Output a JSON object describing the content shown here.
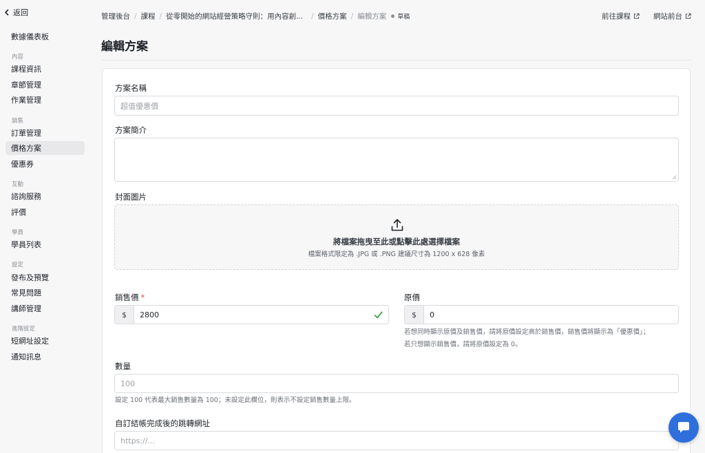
{
  "sidebar": {
    "back_label": "返回",
    "items": [
      {
        "type": "item",
        "label": "數據儀表板"
      },
      {
        "type": "head",
        "label": "內容"
      },
      {
        "type": "item",
        "label": "課程資訊"
      },
      {
        "type": "item",
        "label": "章節管理"
      },
      {
        "type": "item",
        "label": "作業管理"
      },
      {
        "type": "head",
        "label": "銷售"
      },
      {
        "type": "item",
        "label": "訂單管理"
      },
      {
        "type": "item",
        "label": "價格方案",
        "active": true
      },
      {
        "type": "item",
        "label": "優惠券"
      },
      {
        "type": "head",
        "label": "互動"
      },
      {
        "type": "item",
        "label": "諮詢服務"
      },
      {
        "type": "item",
        "label": "評價"
      },
      {
        "type": "head",
        "label": "學員"
      },
      {
        "type": "item",
        "label": "學員列表"
      },
      {
        "type": "head",
        "label": "設定"
      },
      {
        "type": "item",
        "label": "發布及預覽"
      },
      {
        "type": "item",
        "label": "常見問題"
      },
      {
        "type": "item",
        "label": "講師管理"
      },
      {
        "type": "head",
        "label": "進階設定"
      },
      {
        "type": "item",
        "label": "短網址設定"
      },
      {
        "type": "item",
        "label": "通知訊息"
      }
    ]
  },
  "breadcrumb": {
    "items": [
      "管理後台",
      "課程",
      "從零開始的網站經營策略守則：用內容創...",
      "價格方案"
    ],
    "current": "編輯方案",
    "status": "草稿"
  },
  "toplinks": {
    "course": "前往課程",
    "frontend": "網站前台"
  },
  "page_title": "編輯方案",
  "form": {
    "name_label": "方案名稱",
    "name_placeholder": "超值優惠價",
    "intro_label": "方案簡介",
    "cover_label": "封面圖片",
    "cover_main": "將檔案拖曳至此或點擊此處選擇檔案",
    "cover_sub": "檔案格式限定為 .JPG 或 .PNG 建議尺寸為 1200 x 628 像素",
    "sale_label": "銷售價",
    "sale_required": "*",
    "currency": "$",
    "sale_value": "2800",
    "orig_label": "原價",
    "orig_value": "0",
    "orig_hint_1": "若想同時顯示原價及銷售價，請將原價設定高於銷售價，銷售價將顯示為「優惠價」；",
    "orig_hint_2": "若只想顯示銷售價，請將原價設定為 0。",
    "qty_label": "數量",
    "qty_placeholder": "100",
    "qty_hint": "設定 100 代表最大銷售數量為 100；未設定此欄位，則表示不設定銷售數量上限。",
    "redirect_label": "自訂結帳完成後的跳轉網址",
    "redirect_placeholder": "https://..."
  },
  "colors": {
    "accent": "#2f6fdb",
    "success": "#3fa34d",
    "required": "#e5484d"
  }
}
